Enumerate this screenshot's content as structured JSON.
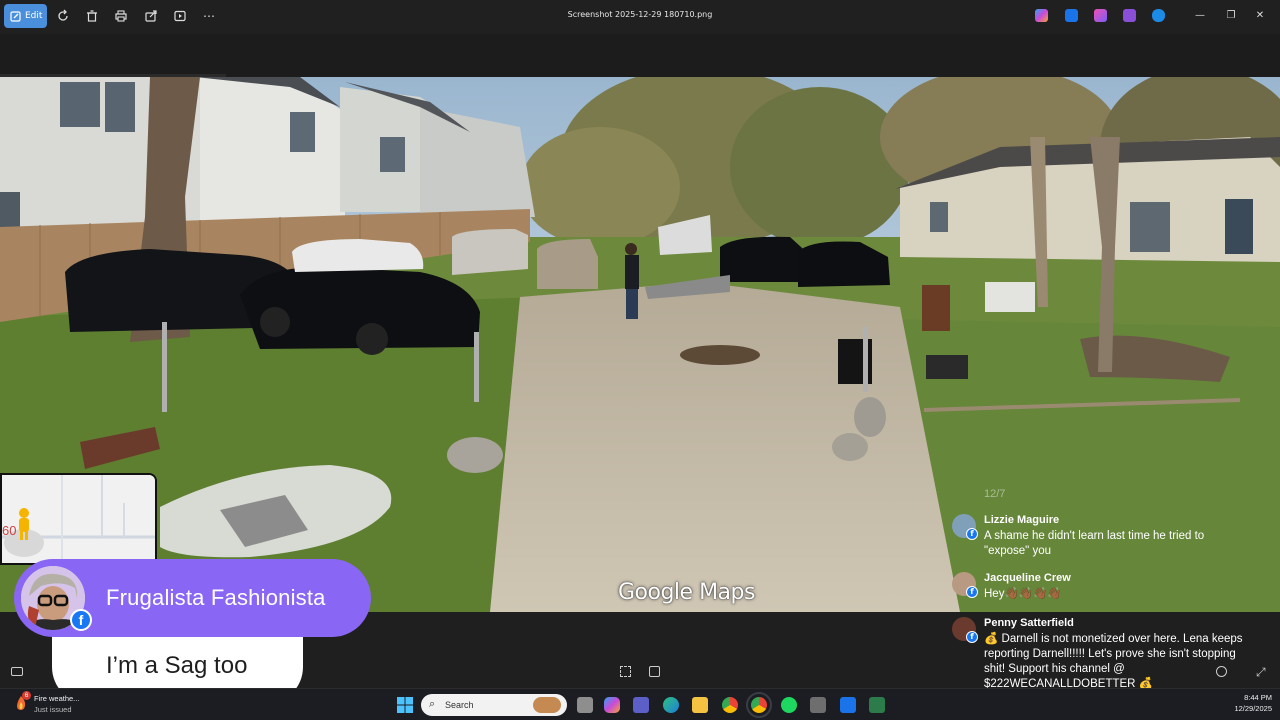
{
  "toolbar": {
    "edit_label": "Edit",
    "icons": [
      "edit-icon",
      "rotate-icon",
      "delete-icon",
      "print-icon",
      "share-icon",
      "slideshow-icon",
      "more-icon"
    ],
    "title": "Screenshot 2025-12-29 180710.png",
    "window_controls": [
      "minimize-icon",
      "restore-icon",
      "close-icon"
    ]
  },
  "scene": {
    "watermark": "Google Maps"
  },
  "minimap": {
    "number_label": "60"
  },
  "comments": {
    "faded_text": "12/7",
    "items": [
      {
        "name": "Lizzie Maguire",
        "text": "A shame he didn't learn last time he tried to \"expose\" you"
      },
      {
        "name": "Jacqueline Crew",
        "text": "Hey👋🏾👋🏾👋🏾👋🏾"
      },
      {
        "name": "Penny Satterfield",
        "text": "💰 Darnell is not monetized over here. Lena keeps reporting Darnell!!!!! Let's prove she isn't stopping shit! Support his channel @ $222WECANALLDOBETTER 💰"
      }
    ]
  },
  "overlay": {
    "name": "Frugalista Fashionista",
    "message": "I’m a Sag too"
  },
  "taskbar": {
    "weather_title": "Fire weathe...",
    "weather_sub": "Just issued",
    "weather_badge": "6",
    "search_placeholder": "Search",
    "time": "8:44 PM",
    "date": "12/29/2025"
  },
  "colors": {
    "accent": "#4a8fdc",
    "pill": "#8a66f4",
    "facebook": "#1877f2"
  }
}
